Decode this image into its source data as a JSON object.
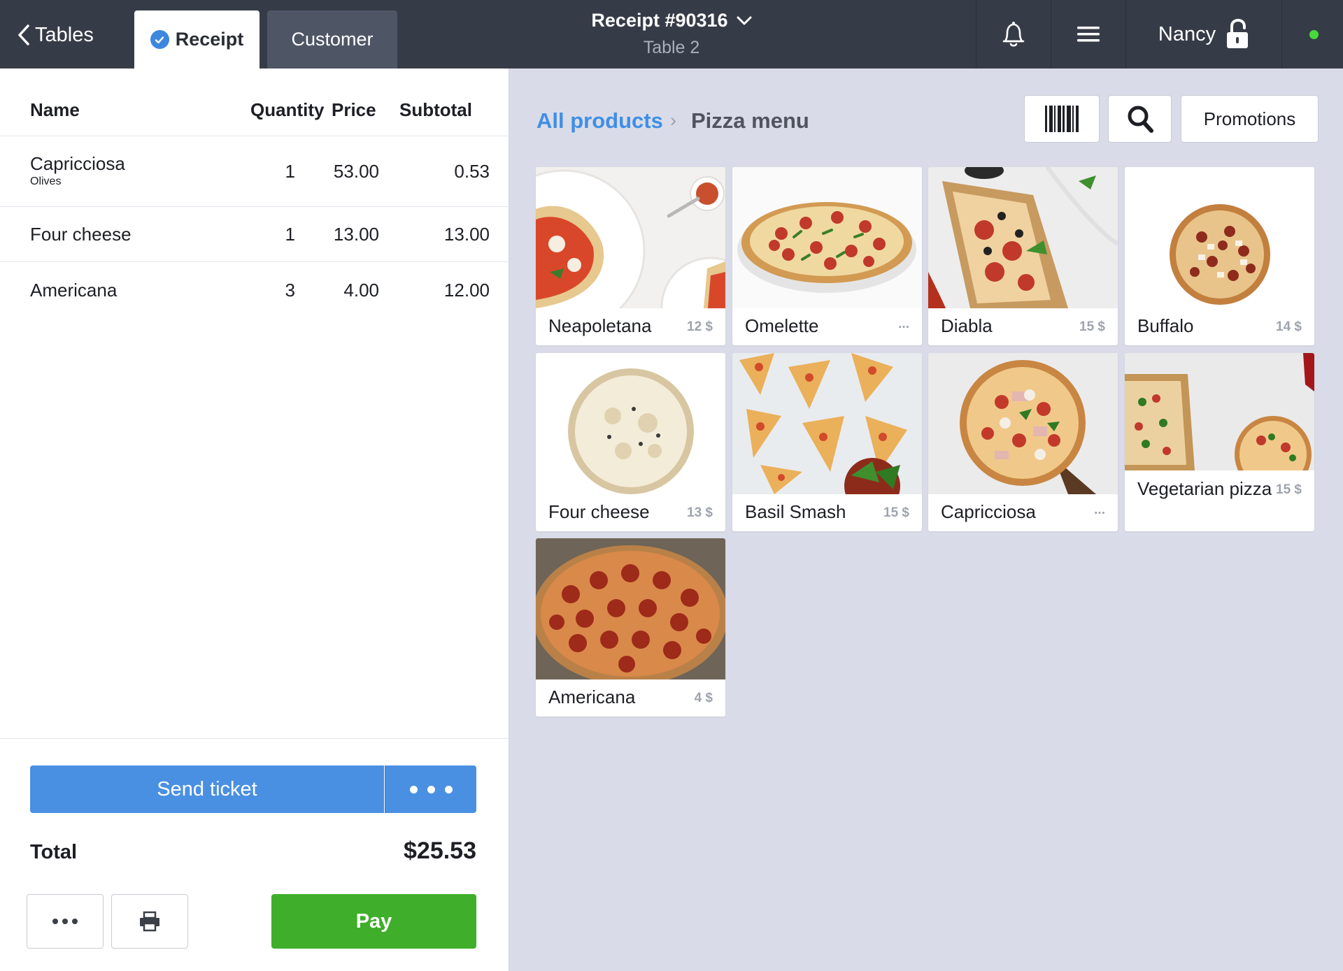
{
  "topbar": {
    "back_label": "Tables",
    "tab_receipt": "Receipt",
    "tab_customer": "Customer",
    "receipt_title": "Receipt #90316",
    "table_label": "Table 2",
    "user_name": "Nancy",
    "status_color": "#47d93a"
  },
  "icons": {
    "back": "chevron-left-icon",
    "check": "check-circle-icon",
    "dropdown": "chevron-down-icon",
    "bell": "bell-icon",
    "menu": "hamburger-menu-icon",
    "lock": "unlocked-padlock-icon",
    "barcode": "barcode-icon",
    "search": "search-icon",
    "print": "printer-icon"
  },
  "receipt": {
    "columns": {
      "name": "Name",
      "quantity": "Quantity",
      "price": "Price",
      "subtotal": "Subtotal"
    },
    "items": [
      {
        "name": "Capricciosa",
        "modifier": "Olives",
        "quantity": "1",
        "price": "53.00",
        "subtotal": "0.53"
      },
      {
        "name": "Four cheese",
        "modifier": "",
        "quantity": "1",
        "price": "13.00",
        "subtotal": "13.00"
      },
      {
        "name": "Americana",
        "modifier": "",
        "quantity": "3",
        "price": "4.00",
        "subtotal": "12.00"
      }
    ],
    "send_ticket_label": "Send ticket",
    "total_label": "Total",
    "total_value": "$25.53",
    "pay_label": "Pay"
  },
  "catalog": {
    "breadcrumb_root": "All products",
    "breadcrumb_separator": "›",
    "breadcrumb_current": "Pizza menu",
    "promotions_label": "Promotions",
    "products": [
      {
        "name": "Neapoletana",
        "price": "12 $"
      },
      {
        "name": "Omelette",
        "price": "..."
      },
      {
        "name": "Diabla",
        "price": "15 $"
      },
      {
        "name": "Buffalo",
        "price": "14 $"
      },
      {
        "name": "Four cheese",
        "price": "13 $"
      },
      {
        "name": "Basil Smash",
        "price": "15 $"
      },
      {
        "name": "Capricciosa",
        "price": "..."
      },
      {
        "name": "Vegetarian pizza",
        "price": "15 $"
      },
      {
        "name": "Americana",
        "price": "4 $"
      }
    ]
  },
  "colors": {
    "topbar": "#363c47",
    "accent_blue": "#4a90e2",
    "pay_green": "#3fae2a",
    "catalog_bg": "#d9dce8"
  }
}
